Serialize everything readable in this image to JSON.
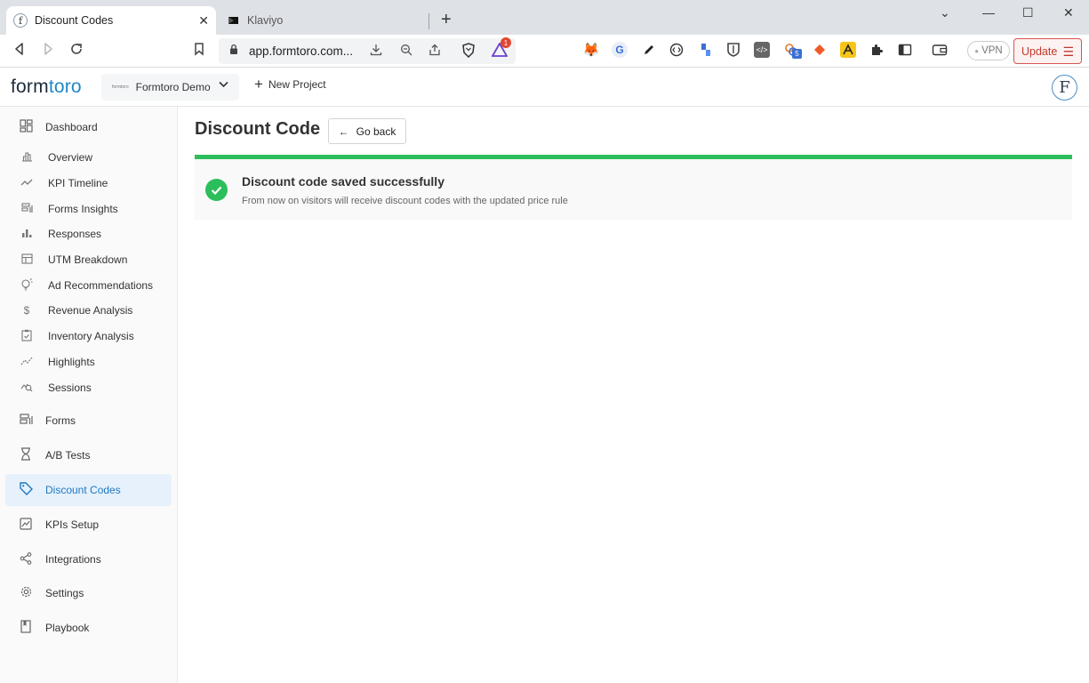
{
  "browser": {
    "tabs": [
      {
        "title": "Discount Codes",
        "favicon": "formtoro-icon"
      },
      {
        "title": "Klaviyo",
        "favicon": "klaviyo-icon"
      }
    ],
    "url": "app.formtoro.com...",
    "vpn_label": "VPN",
    "update_label": "Update",
    "brave_badge_count": "1",
    "ext_badge_count": "5"
  },
  "header": {
    "logo_part1": "form",
    "logo_part2": "toro",
    "project_name": "Formtoro Demo",
    "project_mini_logo": "formtoro",
    "new_project_label": "New Project",
    "avatar_letter": "F"
  },
  "sidebar": {
    "dashboard": "Dashboard",
    "subitems": [
      {
        "label": "Overview",
        "icon": "bar-chart-icon"
      },
      {
        "label": "KPI Timeline",
        "icon": "trend-icon"
      },
      {
        "label": "Forms Insights",
        "icon": "forms-insights-icon"
      },
      {
        "label": "Responses",
        "icon": "responses-icon"
      },
      {
        "label": "UTM Breakdown",
        "icon": "table-icon"
      },
      {
        "label": "Ad Recommendations",
        "icon": "lightbulb-icon"
      },
      {
        "label": "Revenue Analysis",
        "icon": "dollar-icon"
      },
      {
        "label": "Inventory Analysis",
        "icon": "clipboard-icon"
      },
      {
        "label": "Highlights",
        "icon": "highlights-icon"
      },
      {
        "label": "Sessions",
        "icon": "sessions-icon"
      }
    ],
    "forms": "Forms",
    "ab_tests": "A/B Tests",
    "discount_codes": "Discount Codes",
    "kpis_setup": "KPIs Setup",
    "integrations": "Integrations",
    "settings": "Settings",
    "playbook": "Playbook"
  },
  "main": {
    "title": "Discount Code",
    "go_back": "Go back",
    "alert": {
      "title": "Discount code saved successfully",
      "description": "From now on visitors will receive discount codes with the updated price rule"
    }
  },
  "colors": {
    "accent": "#1f78c1",
    "success": "#2cbe5a",
    "active_bg": "#e6f1fb"
  }
}
